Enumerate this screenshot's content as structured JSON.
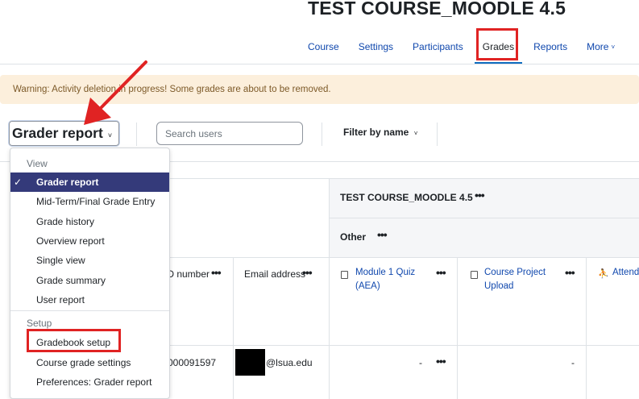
{
  "course": {
    "title": "TEST COURSE_MOODLE 4.5"
  },
  "nav": {
    "items": [
      {
        "label": "Course",
        "active": false
      },
      {
        "label": "Settings",
        "active": false
      },
      {
        "label": "Participants",
        "active": false
      },
      {
        "label": "Grades",
        "active": true
      },
      {
        "label": "Reports",
        "active": false
      },
      {
        "label": "More",
        "active": false
      }
    ],
    "more_chevron": "˅"
  },
  "warning": {
    "text": "Warning: Activity deletion in progress! Some grades are about to be removed."
  },
  "toolbar": {
    "report_select": "Grader report",
    "chevron": "˅",
    "search_placeholder": "Search users",
    "filter_label": "Filter by name"
  },
  "dropdown": {
    "sections": [
      {
        "header": "View",
        "items": [
          {
            "label": "Grader report",
            "selected": true
          },
          {
            "label": "Mid-Term/Final Grade Entry",
            "selected": false
          },
          {
            "label": "Grade history",
            "selected": false
          },
          {
            "label": "Overview report",
            "selected": false
          },
          {
            "label": "Single view",
            "selected": false
          },
          {
            "label": "Grade summary",
            "selected": false
          },
          {
            "label": "User report",
            "selected": false
          }
        ]
      },
      {
        "header": "Setup",
        "items": [
          {
            "label": "Gradebook setup",
            "selected": false
          },
          {
            "label": "Course grade settings",
            "selected": false
          },
          {
            "label": "Preferences: Grader report",
            "selected": false
          }
        ]
      }
    ],
    "check": "✓"
  },
  "table": {
    "course_header": "TEST COURSE_MOODLE 4.5",
    "category_header": "Other",
    "columns": {
      "id_number": "ID number",
      "email": "Email address",
      "item1": "Module 1 Quiz (AEA)",
      "item2": "Course Project Upload",
      "item3": "Attend"
    },
    "row": {
      "id_number": "000091597",
      "email": "@lsua.edu",
      "grade1": "-",
      "grade2": "-"
    },
    "menu_dots": "•••"
  },
  "colors": {
    "primary": "#0f6cbf",
    "link": "#0f47ad",
    "selected_bg": "#343a7a",
    "warning_bg": "#fcefdc",
    "warning_text": "#7d5a29",
    "annotation_red": "#e02323"
  }
}
